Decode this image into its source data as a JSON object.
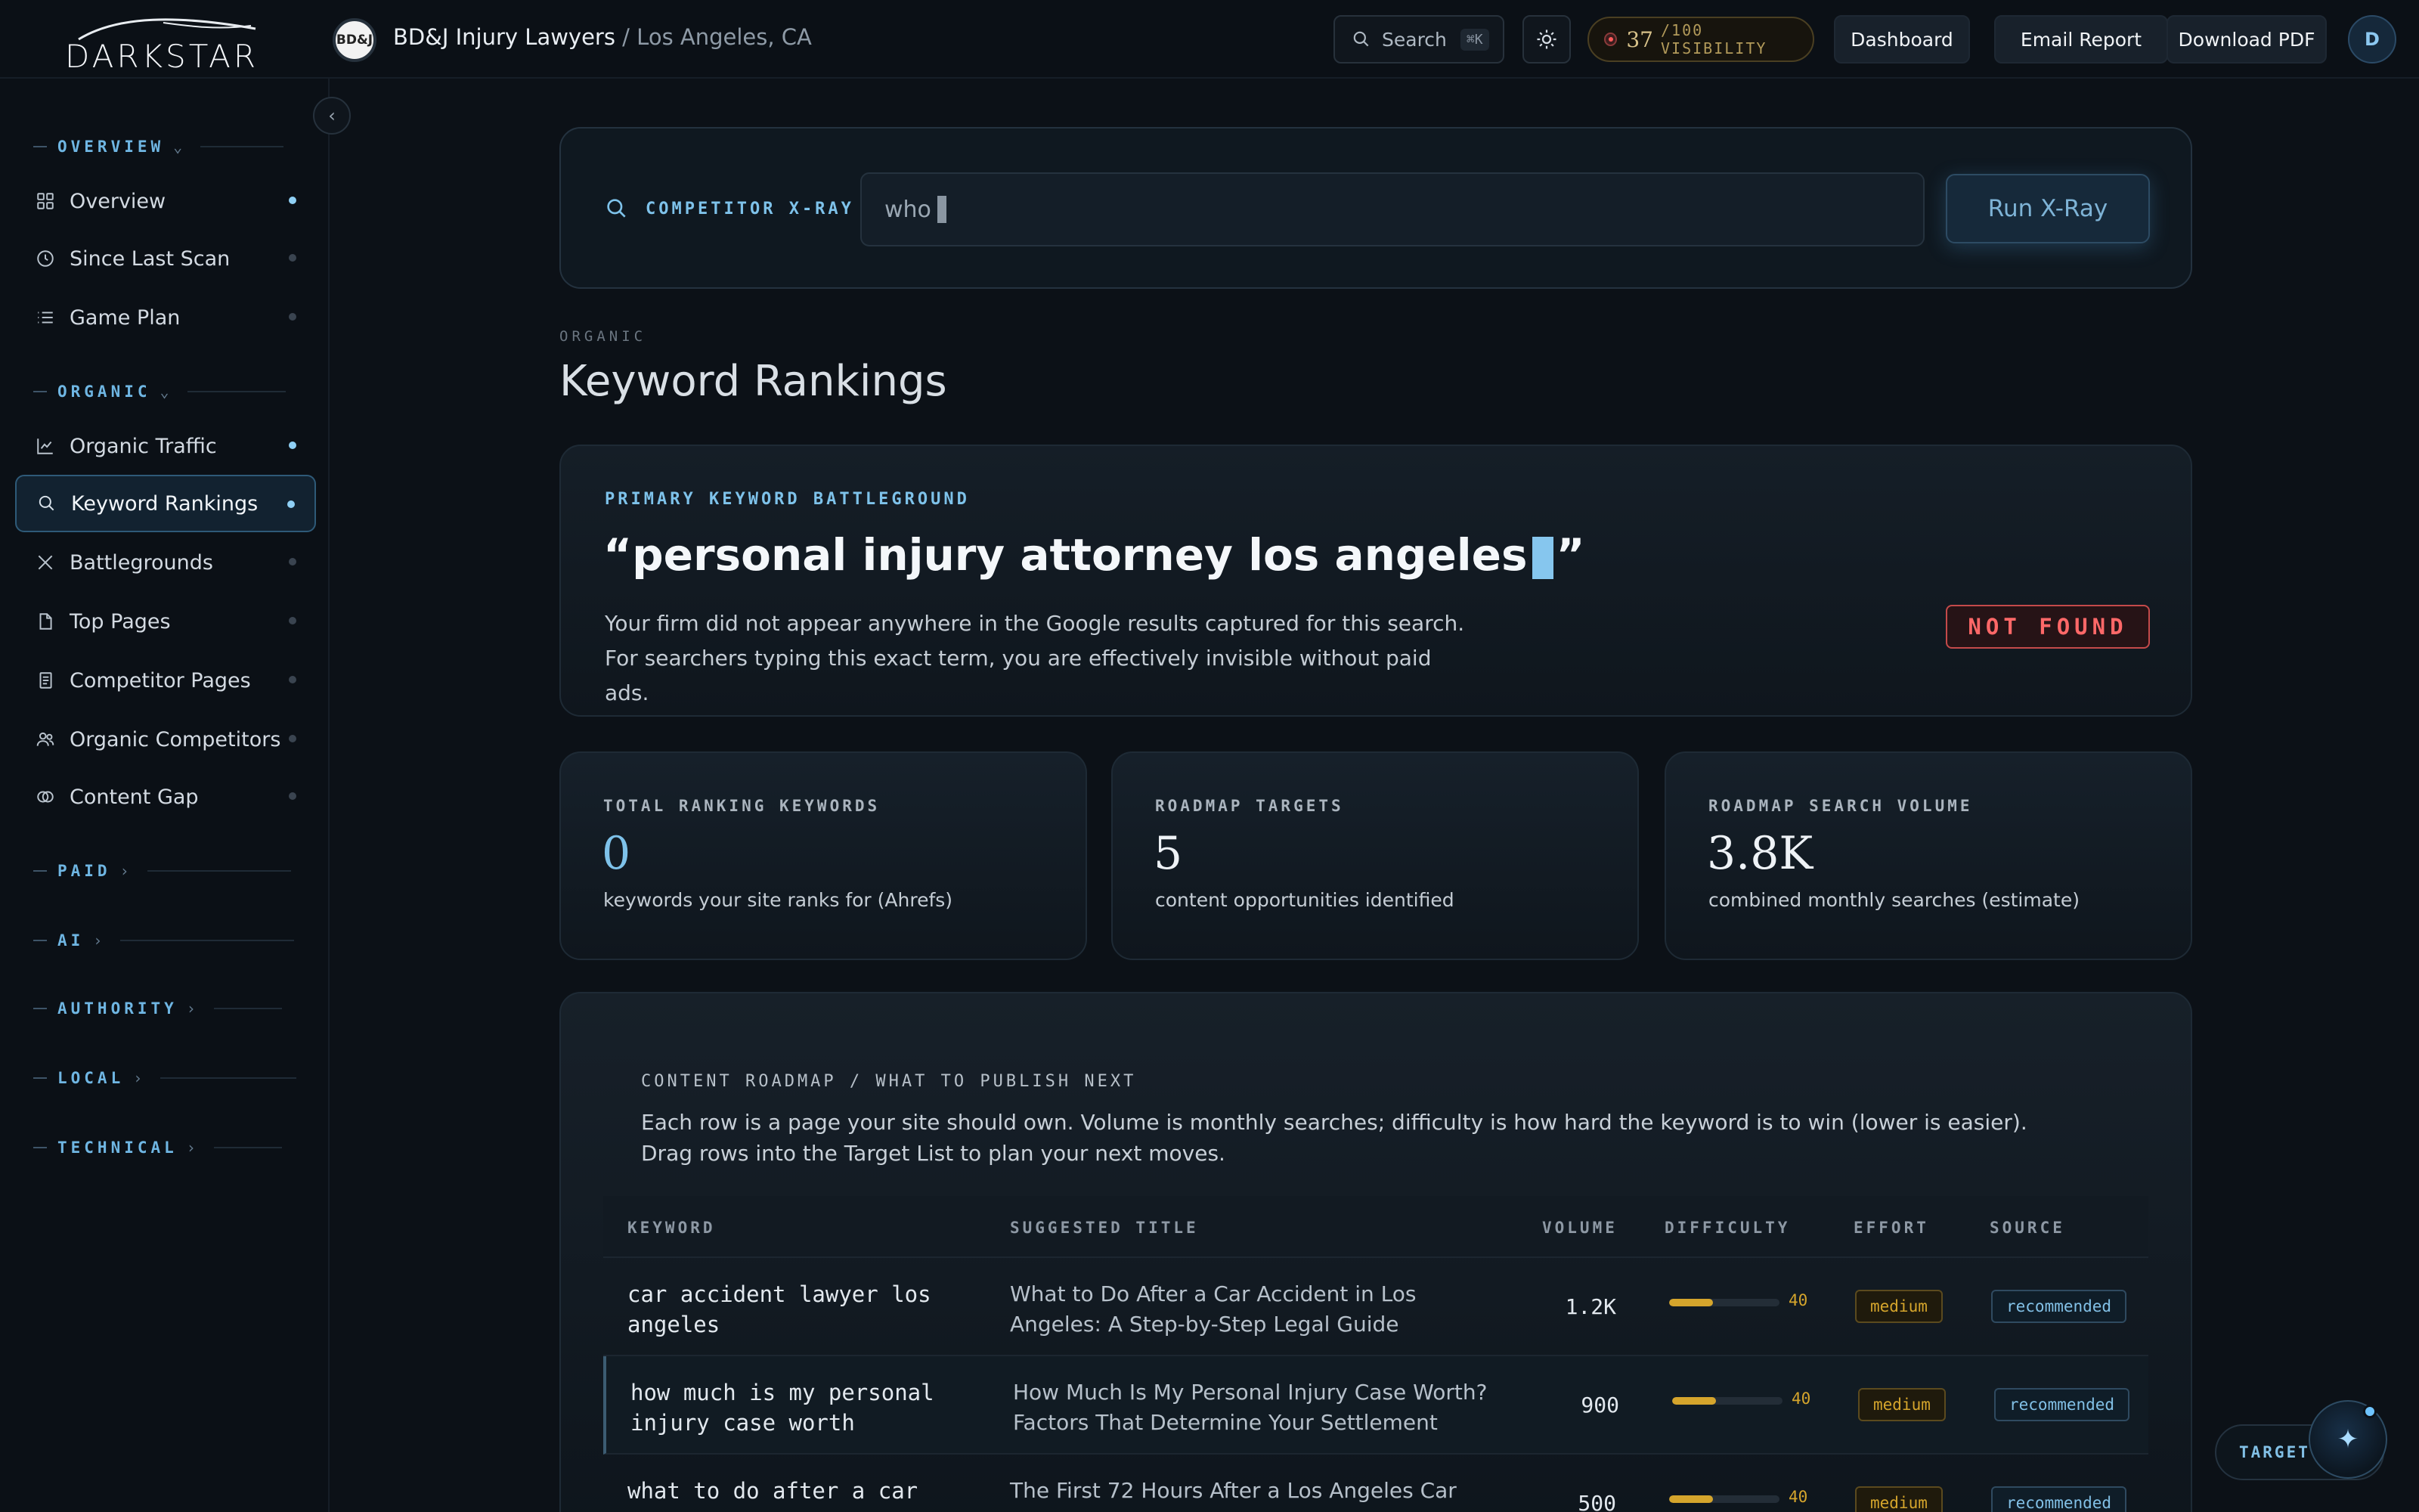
{
  "app": {
    "logo": "DARKSTAR",
    "brand_initials": "BD&J",
    "client_name": "BD&J Injury Lawyers",
    "client_location": " / Los Angeles, CA"
  },
  "topbar": {
    "search_label": "Search",
    "search_shortcut": "⌘K",
    "visibility_score": "37",
    "visibility_suffix": "/100 VISIBILITY",
    "dashboard_label": "Dashboard",
    "email_report_label": "Email Report",
    "download_pdf_label": "Download PDF",
    "user_initial": "D"
  },
  "sidebar": {
    "overview_header": "OVERVIEW",
    "organic_header": "ORGANIC",
    "collapsed_sections": [
      "PAID",
      "AI",
      "AUTHORITY",
      "LOCAL",
      "TECHNICAL"
    ],
    "overview_items": [
      {
        "label": "Overview",
        "icon": "grid-icon",
        "active_dot": true
      },
      {
        "label": "Since Last Scan",
        "icon": "clock-icon",
        "active_dot": false
      },
      {
        "label": "Game Plan",
        "icon": "list-icon",
        "active_dot": false
      }
    ],
    "organic_items": [
      {
        "label": "Organic Traffic",
        "icon": "chart-line-icon",
        "active_dot": true
      },
      {
        "label": "Keyword Rankings",
        "icon": "search-icon",
        "active_dot": true,
        "selected": true
      },
      {
        "label": "Battlegrounds",
        "icon": "swords-icon",
        "active_dot": false
      },
      {
        "label": "Top Pages",
        "icon": "file-icon",
        "active_dot": false
      },
      {
        "label": "Competitor Pages",
        "icon": "document-icon",
        "active_dot": false
      },
      {
        "label": "Organic Competitors",
        "icon": "users-icon",
        "active_dot": false
      },
      {
        "label": "Content Gap",
        "icon": "overlap-icon",
        "active_dot": false
      }
    ]
  },
  "xray": {
    "label": "COMPETITOR X-RAY",
    "input_value": "who",
    "run_label": "Run X-Ray"
  },
  "page": {
    "eyebrow": "ORGANIC",
    "title": "Keyword Rankings"
  },
  "battleground": {
    "eyebrow": "PRIMARY KEYWORD BATTLEGROUND",
    "keyword_open": "“personal injury attorney los angeles",
    "keyword_close": "”",
    "description": "Your firm did not appear anywhere in the Google results captured for this search. For searchers typing this exact term, you are effectively invisible without paid ads.",
    "status": "NOT FOUND",
    "status_color": "#ff6868"
  },
  "stats": [
    {
      "label": "TOTAL RANKING KEYWORDS",
      "value": "0",
      "sub": "keywords your site ranks for (Ahrefs)"
    },
    {
      "label": "ROADMAP TARGETS",
      "value": "5",
      "sub": "content opportunities identified"
    },
    {
      "label": "ROADMAP SEARCH VOLUME",
      "value": "3.8K",
      "sub": "combined monthly searches (estimate)"
    }
  ],
  "roadmap": {
    "eyebrow": "CONTENT ROADMAP / WHAT TO PUBLISH NEXT",
    "description": "Each row is a page your site should own. Volume is monthly searches; difficulty is how hard the keyword is to win (lower is easier). Drag rows into the Target List to plan your next moves.",
    "columns": [
      "KEYWORD",
      "SUGGESTED TITLE",
      "VOLUME",
      "DIFFICULTY",
      "EFFORT",
      "SOURCE"
    ],
    "rows": [
      {
        "keyword": "car accident lawyer los angeles",
        "title": "What to Do After a Car Accident in Los Angeles: A Step-by-Step Legal Guide",
        "volume": "1.2K",
        "difficulty": 40,
        "effort": "medium",
        "source": "recommended"
      },
      {
        "keyword": "how much is my personal injury case worth",
        "title": "How Much Is My Personal Injury Case Worth? Factors That Determine Your Settlement",
        "volume": "900",
        "difficulty": 40,
        "effort": "medium",
        "source": "recommended"
      },
      {
        "keyword": "what to do after a car",
        "title": "The First 72 Hours After a Los Angeles Car",
        "volume": "500",
        "difficulty": 40,
        "effort": "medium",
        "source": "recommended"
      }
    ]
  },
  "floating": {
    "target_label": "TARGET"
  },
  "colors": {
    "accent": "#7ec2ea",
    "warning": "#d5a52c",
    "danger": "#ff6868",
    "background": "#0c1117"
  }
}
